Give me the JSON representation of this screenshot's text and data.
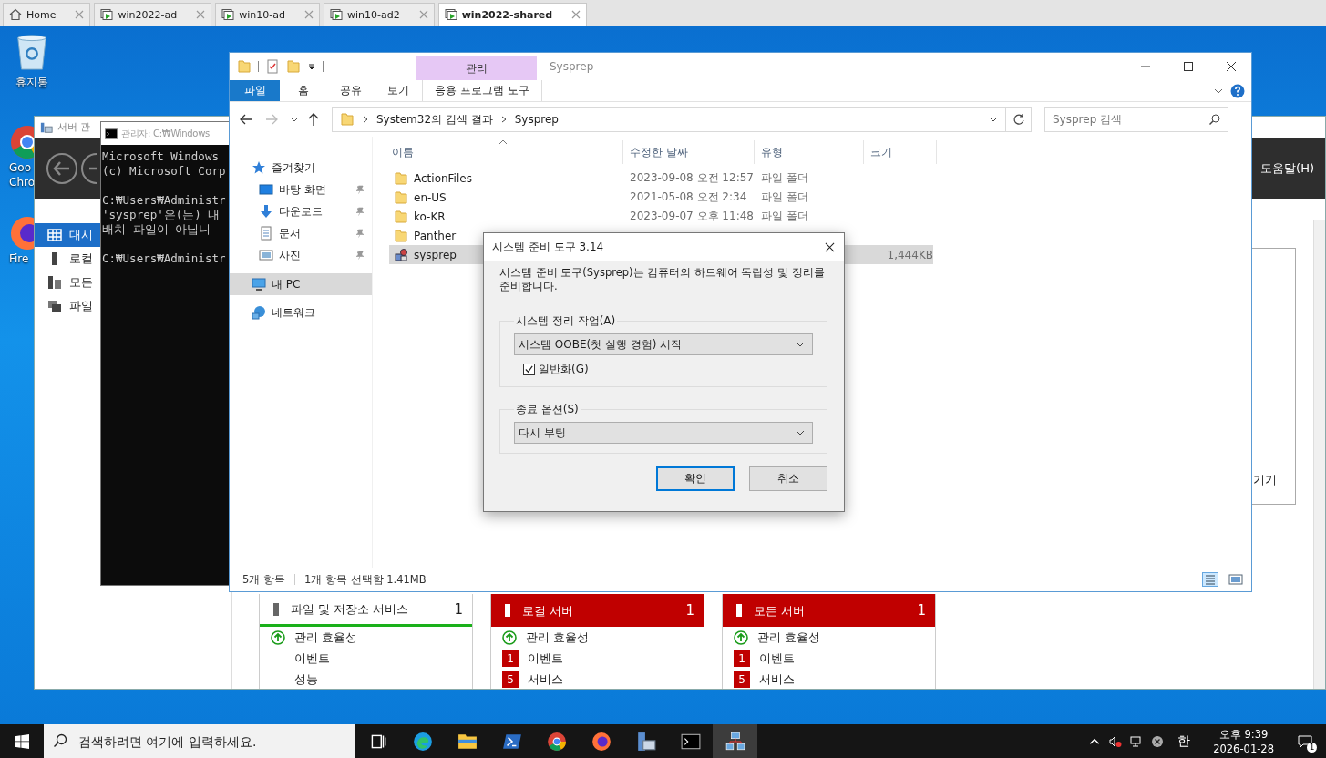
{
  "vm_tabs": [
    {
      "label": "Home",
      "kind": "home",
      "selected": false
    },
    {
      "label": "win2022-ad",
      "kind": "vm",
      "selected": false
    },
    {
      "label": "win10-ad",
      "kind": "vm",
      "selected": false
    },
    {
      "label": "win10-ad2",
      "kind": "vm",
      "selected": false
    },
    {
      "label": "win2022-shared",
      "kind": "vm",
      "selected": true
    }
  ],
  "desktop_icons": [
    {
      "kind": "recycle",
      "lines": [
        "휴지통"
      ]
    },
    {
      "kind": "chrome",
      "lines": [
        "Goo",
        "Chro"
      ]
    },
    {
      "kind": "firefox",
      "lines": [
        "Fire"
      ]
    }
  ],
  "server_manager": {
    "title": "서버 관",
    "help_menu": "도움말(H)",
    "nav": [
      {
        "label": "대시",
        "kind": "dashboard",
        "selected": true
      },
      {
        "label": "로컬",
        "kind": "server",
        "selected": false
      },
      {
        "label": "모든",
        "kind": "servers",
        "selected": false
      },
      {
        "label": "파일",
        "kind": "files",
        "selected": false
      }
    ],
    "tiles": [
      {
        "title": "파일 및 저장소 서비스",
        "count": "1",
        "alert": false,
        "rows": [
          {
            "label": "관리 효율성",
            "kind": "ok"
          },
          {
            "label": "이벤트",
            "kind": "plain"
          },
          {
            "label": "성능",
            "kind": "plain"
          }
        ]
      },
      {
        "title": "로컬 서버",
        "count": "1",
        "alert": true,
        "rows": [
          {
            "label": "관리 효율성",
            "kind": "ok"
          },
          {
            "label": "이벤트",
            "kind": "badge",
            "badge": "1"
          },
          {
            "label": "서비스",
            "kind": "badge",
            "badge": "5"
          }
        ]
      },
      {
        "title": "모든 서버",
        "count": "1",
        "alert": true,
        "rows": [
          {
            "label": "관리 효율성",
            "kind": "ok"
          },
          {
            "label": "이벤트",
            "kind": "badge",
            "badge": "1"
          },
          {
            "label": "서비스",
            "kind": "badge",
            "badge": "5"
          }
        ]
      }
    ],
    "side_text": "기기"
  },
  "cmd": {
    "title": "관리자: C:₩Windows",
    "lines": [
      {
        "text": "Microsoft Windows",
        "kind": "output"
      },
      {
        "text": "(c) Microsoft Corp",
        "kind": "output"
      },
      {
        "text": "C:₩Users₩Administr",
        "kind": "prompt"
      },
      {
        "text": "'sysprep'은(는) 내",
        "kind": "output"
      },
      {
        "text": "배치 파일이 아닙니",
        "kind": "output"
      },
      {
        "text": "C:₩Users₩Administr",
        "kind": "prompt"
      }
    ]
  },
  "explorer": {
    "title": "Sysprep",
    "context_group": "관리",
    "ribbon_tabs": [
      {
        "label": "파일",
        "kind": "file",
        "selected": true
      },
      {
        "label": "홈",
        "kind": "tab",
        "selected": false
      },
      {
        "label": "공유",
        "kind": "tab",
        "selected": false
      },
      {
        "label": "보기",
        "kind": "tab",
        "selected": false
      },
      {
        "label": "응용 프로그램 도구",
        "kind": "context",
        "selected": false
      }
    ],
    "path": [
      "System32의 검색 결과",
      "Sysprep"
    ],
    "search_placeholder": "Sysprep 검색",
    "nav": [
      {
        "label": "즐겨찾기",
        "kind": "star",
        "selected": false,
        "children": [
          {
            "label": "바탕 화면",
            "kind": "desktop",
            "pinned": true,
            "selected": false
          },
          {
            "label": "다운로드",
            "kind": "download",
            "pinned": true,
            "selected": false
          },
          {
            "label": "문서",
            "kind": "document",
            "pinned": true,
            "selected": false
          },
          {
            "label": "사진",
            "kind": "picture",
            "pinned": true,
            "selected": false
          }
        ]
      },
      {
        "label": "내 PC",
        "kind": "pc",
        "selected": true
      },
      {
        "label": "네트워크",
        "kind": "network",
        "selected": false
      }
    ],
    "columns": [
      "이름",
      "수정한 날짜",
      "유형",
      "크기"
    ],
    "rows": [
      {
        "name": "ActionFiles",
        "kind": "folder",
        "modified": "2023-09-08 오전 12:57",
        "type": "파일 폴더",
        "selected": false
      },
      {
        "name": "en-US",
        "kind": "folder",
        "modified": "2021-05-08 오전 2:34",
        "type": "파일 폴더",
        "selected": false
      },
      {
        "name": "ko-KR",
        "kind": "folder",
        "modified": "2023-09-07 오후 11:48",
        "type": "파일 폴더",
        "selected": false
      },
      {
        "name": "Panther",
        "kind": "folder",
        "selected": false
      },
      {
        "name": "sysprep",
        "kind": "app",
        "size": "1,444KB",
        "selected": true
      }
    ],
    "status": {
      "count": "5개 항목",
      "selection": "1개 항목 선택함 1.41MB"
    }
  },
  "dialog": {
    "title": "시스템 준비 도구 3.14",
    "description": "시스템 준비 도구(Sysprep)는 컴퓨터의 하드웨어 독립성 및 정리를 준비합니다.",
    "groups": [
      {
        "legend": "시스템 정리 작업(A)",
        "value": "시스템 OOBE(첫 실행 경험) 시작",
        "checkbox": {
          "label": "일반화(G)",
          "checked": true
        }
      },
      {
        "legend": "종료 옵션(S)",
        "value": "다시 부팅"
      }
    ],
    "buttons": [
      {
        "label": "확인",
        "default": true
      },
      {
        "label": "취소",
        "default": false
      }
    ]
  },
  "taskbar": {
    "search_placeholder": "검색하려면 여기에 입력하세요.",
    "apps": [
      {
        "kind": "taskview",
        "active": false
      },
      {
        "kind": "edge",
        "active": false
      },
      {
        "kind": "explorer",
        "active": false
      },
      {
        "kind": "powershell",
        "active": false
      },
      {
        "kind": "chrome",
        "active": false
      },
      {
        "kind": "firefox",
        "active": false
      },
      {
        "kind": "servermanager",
        "active": false
      },
      {
        "kind": "cmd",
        "active": false
      },
      {
        "kind": "network",
        "active": true
      }
    ],
    "ime": "한",
    "time": "오후 9:39",
    "date": "2026-01-28",
    "notifications": "1"
  }
}
